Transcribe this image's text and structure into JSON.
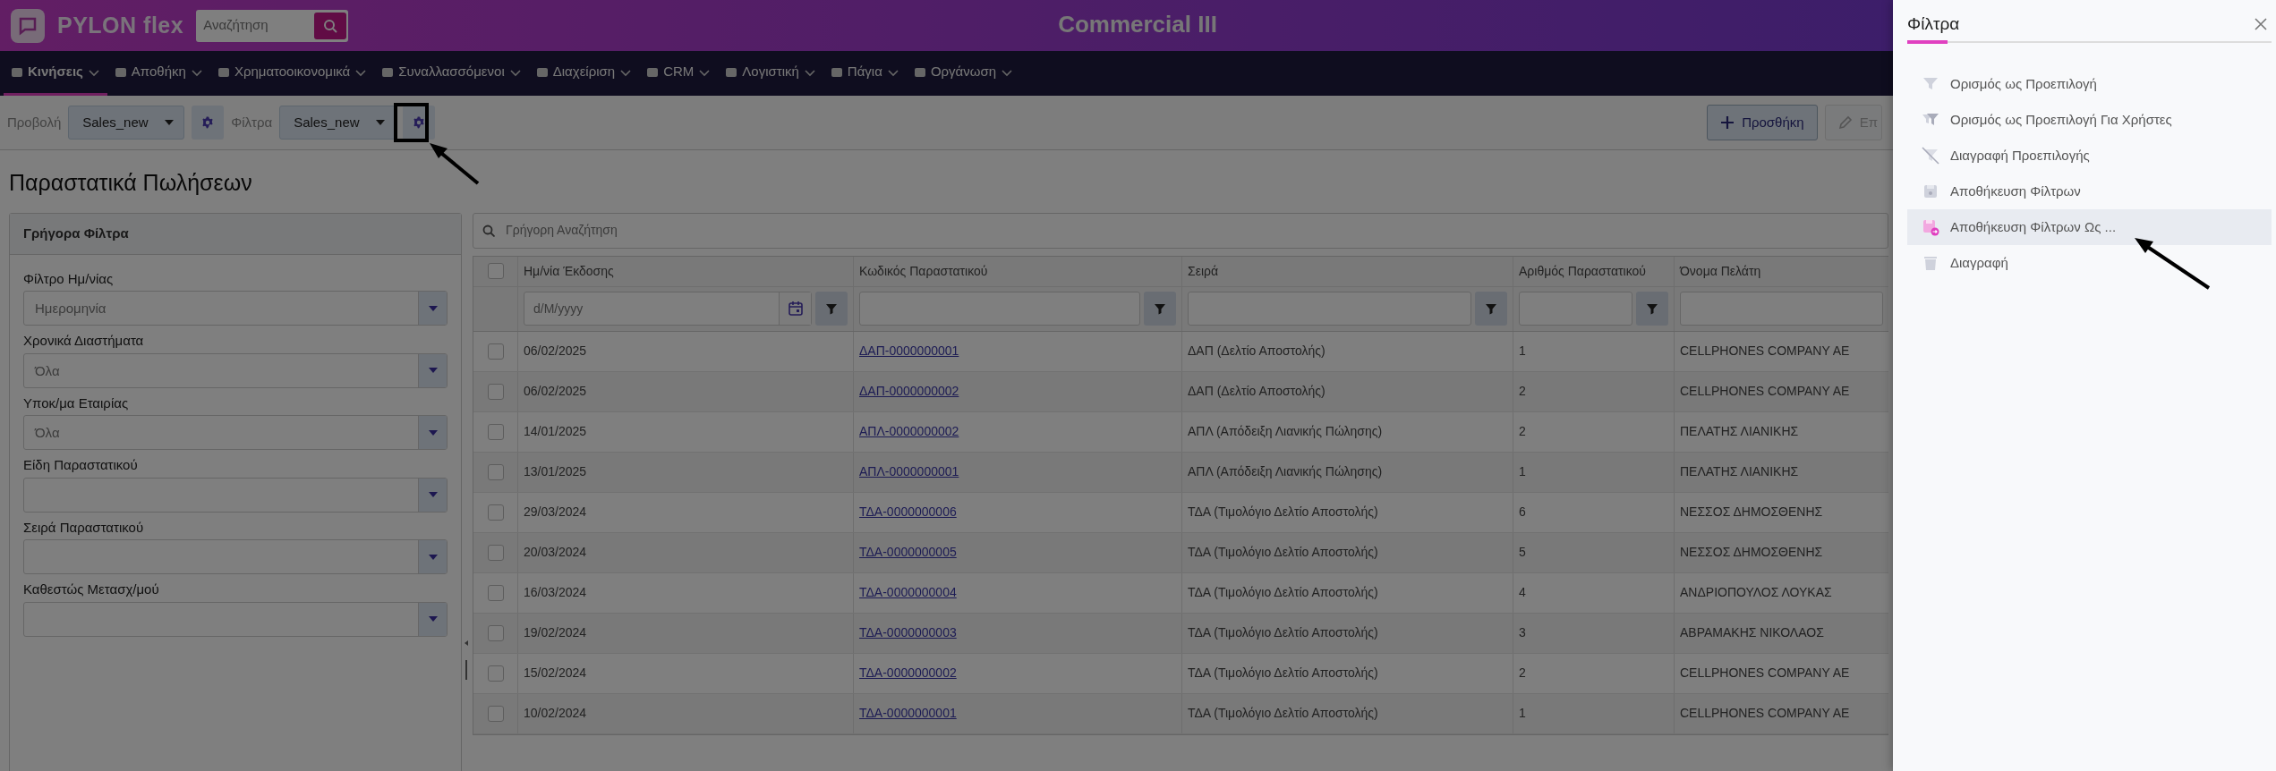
{
  "header": {
    "logo_text": "PYLON flex",
    "search_placeholder": "Αναζήτηση",
    "title": "Commercial III"
  },
  "menu": [
    {
      "label": "Κινήσεις",
      "selected": true
    },
    {
      "label": "Αποθήκη",
      "selected": false
    },
    {
      "label": "Χρηματοοικονομικά",
      "selected": false
    },
    {
      "label": "Συναλλασσόμενοι",
      "selected": false
    },
    {
      "label": "Διαχείριση",
      "selected": false
    },
    {
      "label": "CRM",
      "selected": false
    },
    {
      "label": "Λογιστική",
      "selected": false
    },
    {
      "label": "Πάγια",
      "selected": false
    },
    {
      "label": "Οργάνωση",
      "selected": false
    }
  ],
  "toolbar": {
    "view_label": "Προβολή",
    "view_value": "Sales_new",
    "filter_label": "Φίλτρα",
    "filter_value": "Sales_new",
    "actions": [
      {
        "label": "Προσθήκη",
        "kind": "add",
        "disabled": false
      },
      {
        "label": "Επ",
        "kind": "edit",
        "disabled": true
      }
    ]
  },
  "page_title": "Παραστατικά Πωλήσεων",
  "quick_filters": {
    "title": "Γρήγορα Φίλτρα",
    "fields": [
      {
        "label": "Φίλτρο Ημ/νίας",
        "value": "Ημερομηνία"
      },
      {
        "label": "Χρονικά Διαστήματα",
        "value": "Όλα"
      },
      {
        "label": "Υποκ/μα Εταιρίας",
        "value": "Όλα"
      },
      {
        "label": "Είδη Παραστατικού"
      },
      {
        "label": "Σειρά Παραστατικού"
      },
      {
        "label": "Καθεστώς Μετασχ/μού"
      }
    ]
  },
  "table": {
    "all_checked": false,
    "search_placeholder": "Γρήγορη Αναζήτηση",
    "columns": [
      "Ημ/νία Έκδοσης",
      "Κωδικός Παραστατικού",
      "Σειρά",
      "Αριθμός Παραστατικού",
      "Όνομα Πελάτη"
    ],
    "date_placeholder": "d/M/yyyy",
    "rows": [
      {
        "date": "06/02/2025",
        "code": "ΔΑΠ-0000000001",
        "series": "ΔΑΠ (Δελτίο Αποστολής)",
        "number": "1",
        "customer": "CELLPHONES COMPANY AE",
        "checked": false
      },
      {
        "date": "06/02/2025",
        "code": "ΔΑΠ-0000000002",
        "series": "ΔΑΠ (Δελτίο Αποστολής)",
        "number": "2",
        "customer": "CELLPHONES COMPANY AE",
        "checked": false
      },
      {
        "date": "14/01/2025",
        "code": "ΑΠΛ-0000000002",
        "series": "ΑΠΛ (Απόδειξη Λιανικής Πώλησης)",
        "number": "2",
        "customer": "ΠΕΛΑΤΗΣ ΛΙΑΝΙΚΗΣ",
        "checked": false
      },
      {
        "date": "13/01/2025",
        "code": "ΑΠΛ-0000000001",
        "series": "ΑΠΛ (Απόδειξη Λιανικής Πώλησης)",
        "number": "1",
        "customer": "ΠΕΛΑΤΗΣ ΛΙΑΝΙΚΗΣ",
        "checked": false
      },
      {
        "date": "29/03/2024",
        "code": "ΤΔΑ-0000000006",
        "series": "ΤΔΑ (Τιμολόγιο Δελτίο Αποστολής)",
        "number": "6",
        "customer": "ΝΕΣΣΟΣ ΔΗΜΟΣΘΕΝΗΣ",
        "checked": false
      },
      {
        "date": "20/03/2024",
        "code": "ΤΔΑ-0000000005",
        "series": "ΤΔΑ (Τιμολόγιο Δελτίο Αποστολής)",
        "number": "5",
        "customer": "ΝΕΣΣΟΣ ΔΗΜΟΣΘΕΝΗΣ",
        "checked": false
      },
      {
        "date": "16/03/2024",
        "code": "ΤΔΑ-0000000004",
        "series": "ΤΔΑ (Τιμολόγιο Δελτίο Αποστολής)",
        "number": "4",
        "customer": "ΑΝΔΡΙΟΠΟΥΛΟΣ ΛΟΥΚΑΣ",
        "checked": false
      },
      {
        "date": "19/02/2024",
        "code": "ΤΔΑ-0000000003",
        "series": "ΤΔΑ (Τιμολόγιο Δελτίο Αποστολής)",
        "number": "3",
        "customer": "ΑΒΡΑΜΑΚΗΣ ΝΙΚΟΛΑΟΣ",
        "checked": false
      },
      {
        "date": "15/02/2024",
        "code": "ΤΔΑ-0000000002",
        "series": "ΤΔΑ (Τιμολόγιο Δελτίο Αποστολής)",
        "number": "2",
        "customer": "CELLPHONES COMPANY AE",
        "checked": false
      },
      {
        "date": "10/02/2024",
        "code": "ΤΔΑ-0000000001",
        "series": "ΤΔΑ (Τιμολόγιο Δελτίο Αποστολής)",
        "number": "1",
        "customer": "CELLPHONES COMPANY AE",
        "checked": false
      }
    ]
  },
  "filters_panel": {
    "title": "Φίλτρα",
    "items": [
      {
        "label": "Ορισμός ως Προεπιλογή",
        "kind": "funnel",
        "selected": false
      },
      {
        "label": "Ορισμός ως Προεπιλογή Για Χρήστες",
        "kind": "funnels",
        "selected": false
      },
      {
        "label": "Διαγραφή Προεπιλογής",
        "kind": "funnel-off",
        "selected": false
      },
      {
        "label": "Αποθήκευση Φίλτρων",
        "kind": "save",
        "selected": false
      },
      {
        "label": "Αποθήκευση Φίλτρων Ως ...",
        "kind": "save-as",
        "selected": true
      },
      {
        "label": "Διαγραφή",
        "kind": "trash",
        "selected": false
      }
    ]
  }
}
